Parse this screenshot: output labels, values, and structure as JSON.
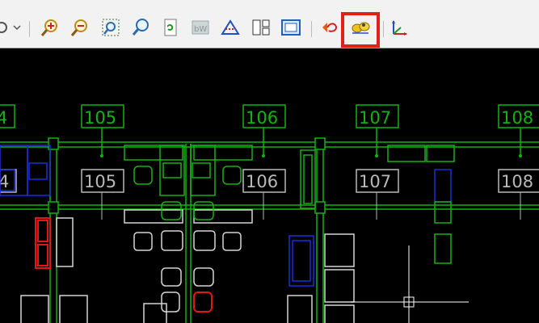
{
  "toolbar": {
    "buttons": [
      {
        "name": "orbit-dropdown-icon"
      },
      {
        "name": "zoom-in-icon"
      },
      {
        "name": "zoom-out-icon"
      },
      {
        "name": "zoom-window-icon"
      },
      {
        "name": "zoom-realtime-icon"
      },
      {
        "name": "regenerate-icon"
      },
      {
        "name": "black-white-icon"
      },
      {
        "name": "visual-style-icon"
      },
      {
        "name": "layout-viewport-icon"
      },
      {
        "name": "frame-icon"
      },
      {
        "name": "undo-view-icon"
      },
      {
        "name": "walkthrough-icon"
      },
      {
        "name": "ucs-icon"
      }
    ],
    "highlighted_button": "walkthrough-icon"
  },
  "drawing": {
    "grid_labels_top": [
      "4",
      "105",
      "106",
      "107",
      "108"
    ],
    "room_labels": [
      "4",
      "105",
      "106",
      "107",
      "108"
    ],
    "colors": {
      "grid": "#11b311",
      "room_label": "#b9b9b9",
      "furniture_white": "#d6d6d6",
      "furniture_green": "#18b018",
      "furniture_blue": "#1a2fd8",
      "furniture_red": "#e01818",
      "highlight": "#e0201b"
    }
  }
}
